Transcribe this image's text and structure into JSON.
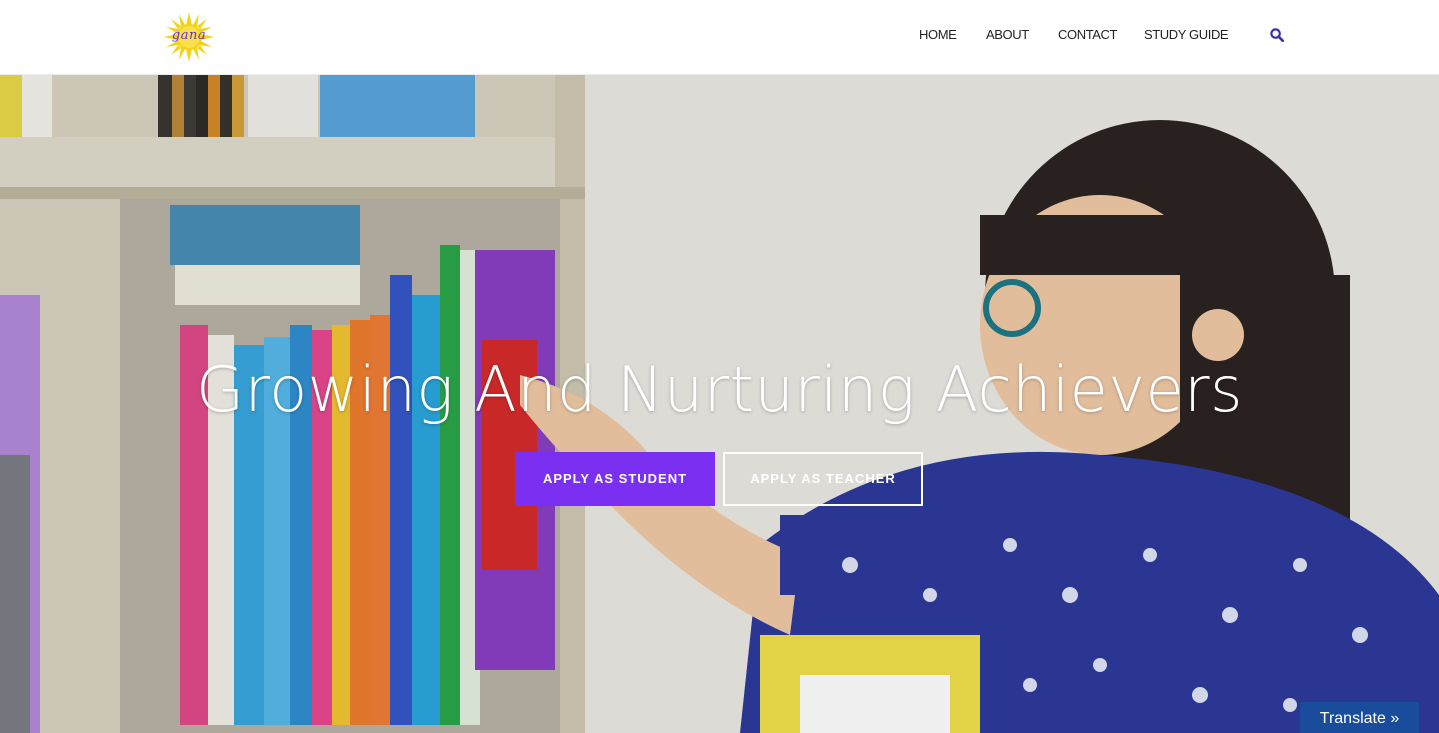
{
  "header": {
    "logo_text": "gana",
    "nav": {
      "home": "HOME",
      "about": "ABOUT",
      "contact": "CONTACT",
      "study_guide": "STUDY GUIDE"
    },
    "search_icon": "search-icon"
  },
  "hero": {
    "title": "Growing And Nurturing Achievers",
    "student_button": "APPLY AS STUDENT",
    "teacher_button": "APPLY AS TEACHER"
  },
  "translate": {
    "label": "Translate »"
  },
  "colors": {
    "accent": "#7b2ff0",
    "nav_icon": "#3a2fb0",
    "translate_bg": "#1a4c9c",
    "logo_sun": "#f2d21a"
  }
}
